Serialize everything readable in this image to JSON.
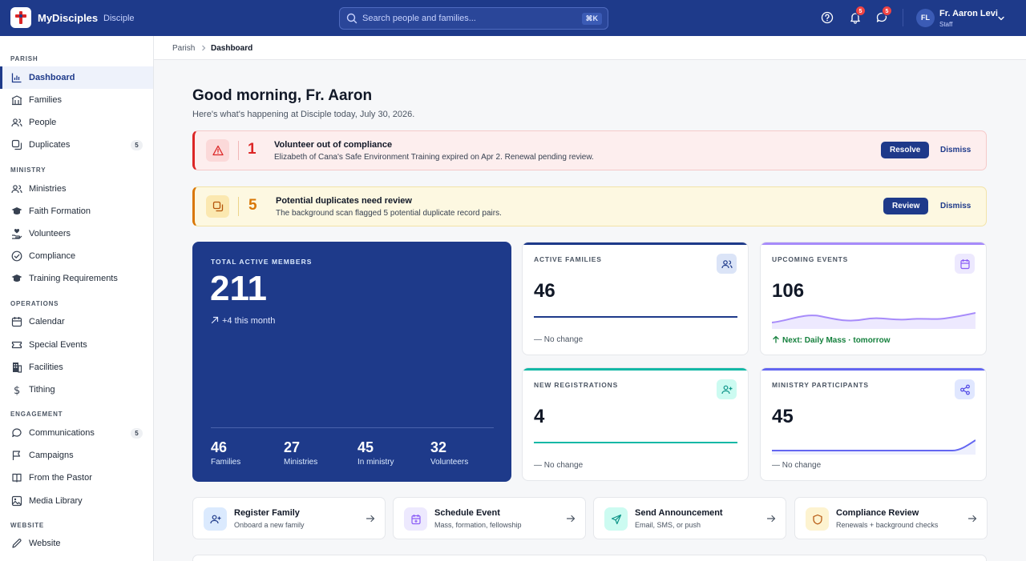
{
  "header": {
    "brand": "MyDisciples",
    "brand_sub": "Disciple",
    "search_placeholder": "Search people and families...",
    "search_shortcut": "⌘K",
    "notifications_count": "5",
    "messages_count": "5",
    "user_initials": "FL",
    "user_name": "Fr. Aaron Levi",
    "user_role": "Staff"
  },
  "sidebar": {
    "sections": [
      {
        "title": "PARISH",
        "items": [
          {
            "label": "Dashboard",
            "icon": "chart-icon",
            "active": true
          },
          {
            "label": "Families",
            "icon": "building-icon"
          },
          {
            "label": "People",
            "icon": "people-icon"
          },
          {
            "label": "Duplicates",
            "icon": "copy-icon",
            "count": "5"
          }
        ]
      },
      {
        "title": "MINISTRY",
        "items": [
          {
            "label": "Ministries",
            "icon": "people-icon"
          },
          {
            "label": "Faith Formation",
            "icon": "graduation-cap-icon"
          },
          {
            "label": "Volunteers",
            "icon": "hand-heart-icon"
          },
          {
            "label": "Compliance",
            "icon": "check-circle-icon"
          },
          {
            "label": "Training Requirements",
            "icon": "graduation-cap-icon"
          }
        ]
      },
      {
        "title": "OPERATIONS",
        "items": [
          {
            "label": "Calendar",
            "icon": "calendar-icon"
          },
          {
            "label": "Special Events",
            "icon": "ticket-icon"
          },
          {
            "label": "Facilities",
            "icon": "building-icon"
          },
          {
            "label": "Tithing",
            "icon": "dollar-icon"
          }
        ]
      },
      {
        "title": "ENGAGEMENT",
        "items": [
          {
            "label": "Communications",
            "icon": "message-icon",
            "count": "5"
          },
          {
            "label": "Campaigns",
            "icon": "flag-icon"
          },
          {
            "label": "From the Pastor",
            "icon": "book-icon"
          },
          {
            "label": "Media Library",
            "icon": "image-icon"
          }
        ]
      },
      {
        "title": "WEBSITE",
        "items": [
          {
            "label": "Website",
            "icon": "pencil-icon"
          }
        ]
      }
    ]
  },
  "breadcrumb": {
    "parent": "Parish",
    "current": "Dashboard"
  },
  "main": {
    "greeting": "Good morning, Fr. Aaron",
    "subtitle": "Here's what's happening at Disciple today, July 30, 2026.",
    "alerts": [
      {
        "count": "1",
        "title": "Volunteer out of compliance",
        "desc": "Elizabeth of Cana's Safe Environment Training expired on Apr 2. Renewal pending review.",
        "action": "Resolve",
        "dismiss": "Dismiss",
        "color": "#dc2626"
      },
      {
        "count": "5",
        "title": "Potential duplicates need review",
        "desc": "The background scan flagged 5 potential duplicate record pairs.",
        "action": "Review",
        "dismiss": "Dismiss",
        "color": "#d97706"
      }
    ],
    "total": {
      "label": "TOTAL ACTIVE MEMBERS",
      "value": "211",
      "trend": "+4 this month",
      "stats": [
        {
          "value": "46",
          "label": "Families"
        },
        {
          "value": "27",
          "label": "Ministries"
        },
        {
          "value": "45",
          "label": "In ministry"
        },
        {
          "value": "32",
          "label": "Volunteers"
        }
      ]
    },
    "cards": [
      {
        "label": "ACTIVE FAMILIES",
        "value": "46",
        "foot": "No change",
        "color": "#1e3a8a"
      },
      {
        "label": "UPCOMING EVENTS",
        "value": "106",
        "foot": "Next: Daily Mass · tomorrow",
        "color": "#a78bfa"
      },
      {
        "label": "NEW REGISTRATIONS",
        "value": "4",
        "foot": "No change",
        "color": "#14b8a6"
      },
      {
        "label": "MINISTRY PARTICIPANTS",
        "value": "45",
        "foot": "No change",
        "color": "#6366f1"
      }
    ],
    "quick_actions": [
      {
        "title": "Register Family",
        "desc": "Onboard a new family"
      },
      {
        "title": "Schedule Event",
        "desc": "Mass, formation, fellowship"
      },
      {
        "title": "Send Announcement",
        "desc": "Email, SMS, or push"
      },
      {
        "title": "Compliance Review",
        "desc": "Renewals + background checks"
      }
    ]
  }
}
